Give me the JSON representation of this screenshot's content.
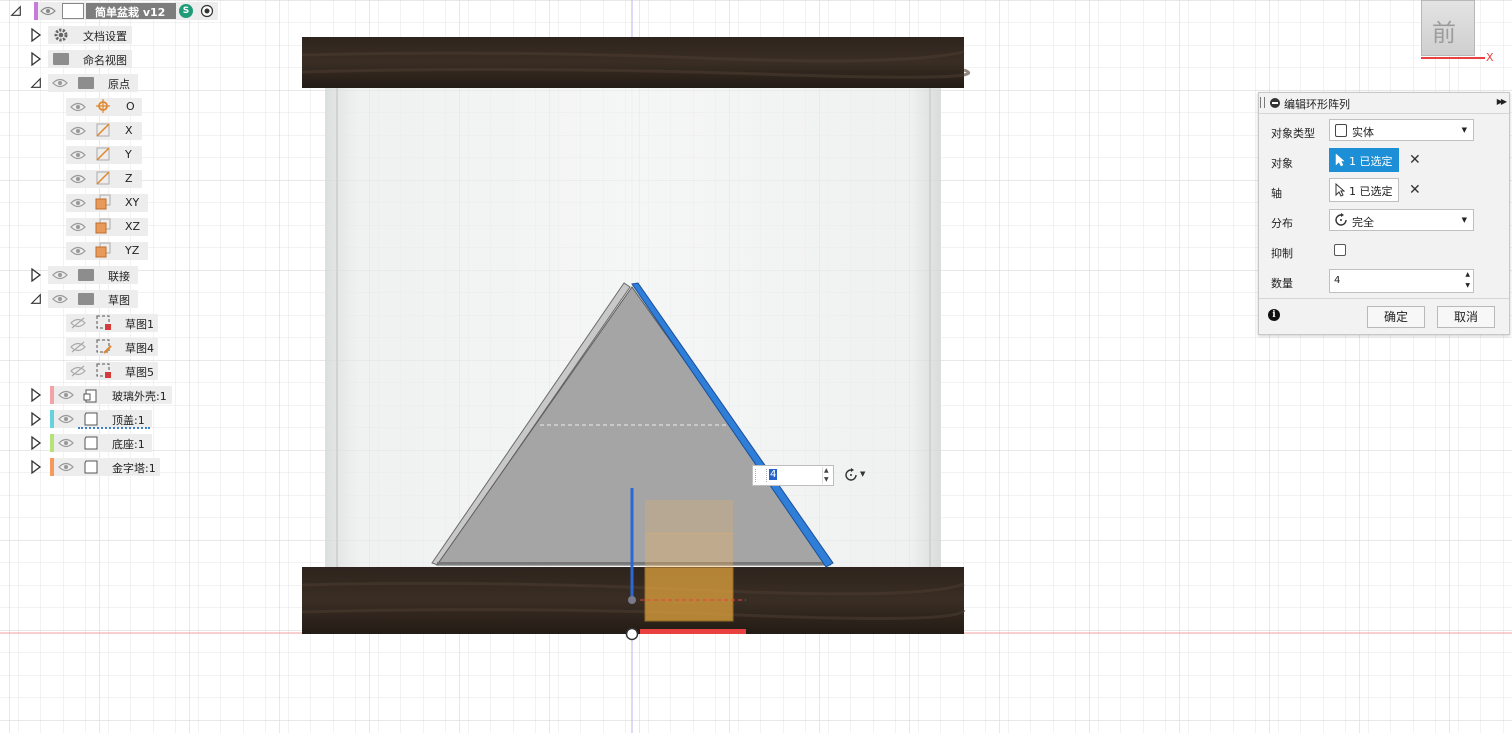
{
  "browser": {
    "root_label": "简单盆栽 v12",
    "root_badge": "S",
    "items": {
      "doc_settings": "文档设置",
      "named_views": "命名视图",
      "origin": "原点",
      "origin_o": "O",
      "origin_x": "X",
      "origin_y": "Y",
      "origin_z": "Z",
      "origin_xy": "XY",
      "origin_xz": "XZ",
      "origin_yz": "YZ",
      "joints": "联接",
      "sketches": "草图",
      "sketch1": "草图1",
      "sketch4": "草图4",
      "sketch5": "草图5",
      "glass_shell": "玻璃外壳:1",
      "top_cover": "顶盖:1",
      "base": "底座:1",
      "pyramid": "金字塔:1"
    }
  },
  "viewcube": {
    "face_label": "前",
    "axis_label": "X"
  },
  "canvas": {
    "count_input_value": "4"
  },
  "dialog": {
    "title": "编辑环形阵列",
    "object_type_label": "对象类型",
    "object_type_value": "实体",
    "objects_label": "对象",
    "objects_value": "1 已选定",
    "axis_label": "轴",
    "axis_value": "1 已选定",
    "distribution_label": "分布",
    "distribution_value": "完全",
    "suppress_label": "抑制",
    "quantity_label": "数量",
    "quantity_value": "4",
    "ok_label": "确定",
    "cancel_label": "取消"
  },
  "colors": {
    "selection_blue": "#1c8fd6",
    "glass_shell_tag": "#f2a3a8",
    "top_cover_tag": "#66d3dc",
    "base_tag": "#b6e27a",
    "pyramid_tag": "#f59a5c",
    "root_tag": "#c77bd9",
    "axis_red": "#e94040",
    "wood_dark": "#2a211b"
  }
}
